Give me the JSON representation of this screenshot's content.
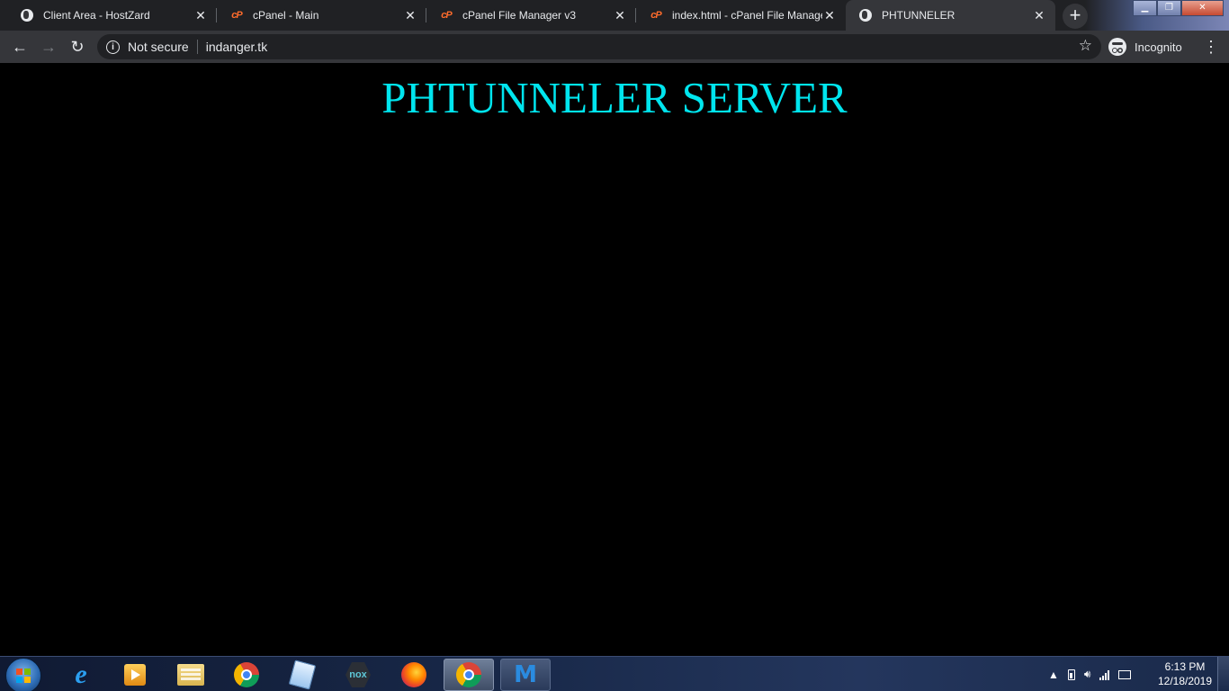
{
  "browser": {
    "tabs": [
      {
        "title": "Client Area - HostZard",
        "favicon": "globe-icon",
        "active": false
      },
      {
        "title": "cPanel - Main",
        "favicon": "cpanel-icon",
        "active": false
      },
      {
        "title": "cPanel File Manager v3",
        "favicon": "cpanel-icon",
        "active": false
      },
      {
        "title": "index.html - cPanel File Manager",
        "favicon": "cpanel-icon",
        "active": false
      },
      {
        "title": "PHTUNNELER",
        "favicon": "globe-icon",
        "active": true
      }
    ],
    "security_label": "Not secure",
    "url": "indanger.tk",
    "profile_label": "Incognito"
  },
  "page": {
    "heading": "PHTUNNELER SERVER",
    "heading_color": "#00e5ee",
    "background_color": "#000000"
  },
  "taskbar": {
    "apps": [
      "internet-explorer",
      "media-player",
      "file-explorer",
      "chrome",
      "notepad",
      "nox",
      "firefox",
      "chrome-active",
      "malwarebytes"
    ],
    "clock_time": "6:13 PM",
    "clock_date": "12/18/2019"
  }
}
